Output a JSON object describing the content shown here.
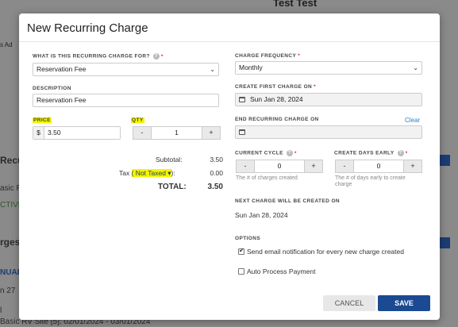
{
  "background": {
    "title": "Test Test",
    "tabs": "s    Ad",
    "left_texts": [
      "Recurri",
      "asic R",
      "CTIVE",
      "rges",
      "NUAL",
      "n 27",
      "l",
      "Basic RV Site [5]: 02/01/2024 - 03/01/2024"
    ]
  },
  "modal": {
    "title": "New Recurring Charge",
    "left": {
      "charge_for_label": "What is this recurring charge for?",
      "charge_for_value": "Reservation Fee",
      "description_label": "Description",
      "description_value": "Reservation Fee",
      "price_label": "Price",
      "price_prefix": "$",
      "price_value": "3.50",
      "qty_label": "Qty",
      "qty_value": "1",
      "minus": "-",
      "plus": "+",
      "subtotal_label": "Subtotal:",
      "subtotal_value": "3.50",
      "tax_prefix": "Tax",
      "tax_select": "( Not Taxed ▾",
      "tax_suffix": "):",
      "tax_value": "0.00",
      "total_label": "TOTAL:",
      "total_value": "3.50"
    },
    "right": {
      "frequency_label": "Charge Frequency",
      "frequency_value": "Monthly",
      "first_charge_label": "Create First Charge On",
      "first_charge_value": "Sun Jan 28, 2024",
      "end_label": "End Recurring Charge On",
      "end_clear": "Clear",
      "end_value": "",
      "cycle_label": "Current Cycle",
      "cycle_value": "0",
      "cycle_hint": "The # of charges created",
      "days_early_label": "Create Days Early",
      "days_early_value": "0",
      "days_early_hint": "The # of days early to create charge",
      "next_label": "Next Charge Will Be Created On",
      "next_value": "Sun Jan 28, 2024",
      "options_label": "Options",
      "opt_email": "Send email notification for every new charge created",
      "opt_email_checked": true,
      "opt_auto": "Auto Process Payment",
      "opt_auto_checked": false,
      "help": "?",
      "minus": "-",
      "plus": "+"
    },
    "footer": {
      "cancel": "CANCEL",
      "save": "SAVE"
    }
  },
  "colors": {
    "primary": "#1b4a92",
    "required": "#d0264b",
    "link": "#2a7fc6",
    "highlight": "#f5f500"
  }
}
